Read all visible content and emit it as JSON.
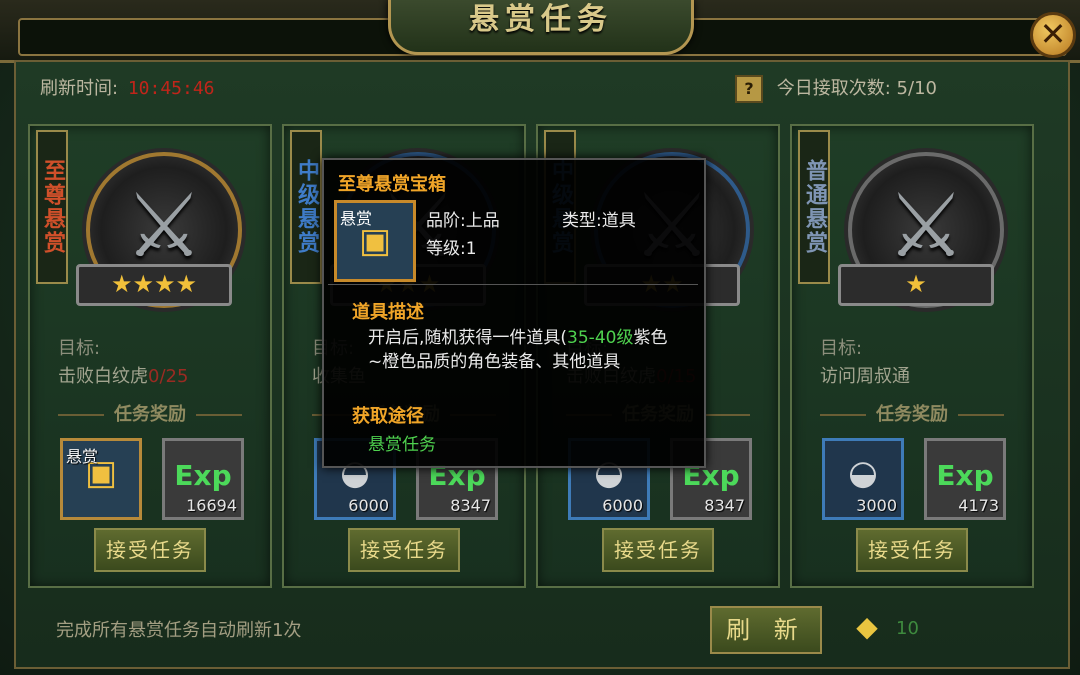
{
  "header": {
    "title": "悬赏任务"
  },
  "status": {
    "refresh_label": "刷新时间:",
    "refresh_time": "10:45:46",
    "help_icon": "?",
    "daily_label": "今日接取次数:",
    "daily_count": "5/10"
  },
  "reward_heading": "任务奖励",
  "goal_label": "目标:",
  "accept_label": "接受任务",
  "cards": [
    {
      "tier": "至尊悬赏",
      "tier_color": "#d0502a",
      "stars": 4,
      "stars_text": "★★★★",
      "goal": "击败白纹虎",
      "progress": "0/25",
      "rewards": [
        {
          "kind": "chest",
          "caption": "悬赏",
          "glyph": "▣"
        },
        {
          "kind": "exp",
          "glyph": "Exp",
          "amount": "16694"
        }
      ]
    },
    {
      "tier": "中级悬赏",
      "tier_color": "#3f7cc8",
      "stars": 3,
      "stars_text": "★★★",
      "goal": "收集鱼",
      "progress": "",
      "rewards": [
        {
          "kind": "silver",
          "glyph": "◒",
          "amount": "6000"
        },
        {
          "kind": "exp",
          "glyph": "Exp",
          "amount": "8347"
        }
      ]
    },
    {
      "tier": "中级悬赏",
      "tier_color": "#3f7cc8",
      "stars": 2,
      "stars_text": "★★",
      "goal": "击败白纹虎",
      "progress": "0/15",
      "rewards": [
        {
          "kind": "silver",
          "glyph": "◒",
          "amount": "6000"
        },
        {
          "kind": "exp",
          "glyph": "Exp",
          "amount": "8347"
        }
      ]
    },
    {
      "tier": "普通悬赏",
      "tier_color": "#7f95b4",
      "stars": 1,
      "stars_text": "★",
      "goal": "访问周叔通",
      "progress": "",
      "rewards": [
        {
          "kind": "silver",
          "glyph": "◒",
          "amount": "3000"
        },
        {
          "kind": "exp",
          "glyph": "Exp",
          "amount": "4173"
        }
      ]
    }
  ],
  "footer": {
    "auto_refresh_text": "完成所有悬赏任务自动刷新1次",
    "refresh_button": "刷 新",
    "gold_amount": "10"
  },
  "tooltip": {
    "name": "至尊悬赏宝箱",
    "slot_caption": "悬赏",
    "grade": "品阶:上品",
    "type": "类型:道具",
    "level": "等级:1",
    "desc_heading": "道具描述",
    "desc_pre": "开启后,随机获得一件道具(",
    "desc_green": "35-40级",
    "desc_post": "紫色~橙色品质的角色装备、其他道具",
    "source_heading": "获取途径",
    "source": "悬赏任务"
  },
  "icons": {
    "close": "close-icon",
    "swords": "crossed-swords-icon",
    "gold": "gold-ingot-icon"
  }
}
